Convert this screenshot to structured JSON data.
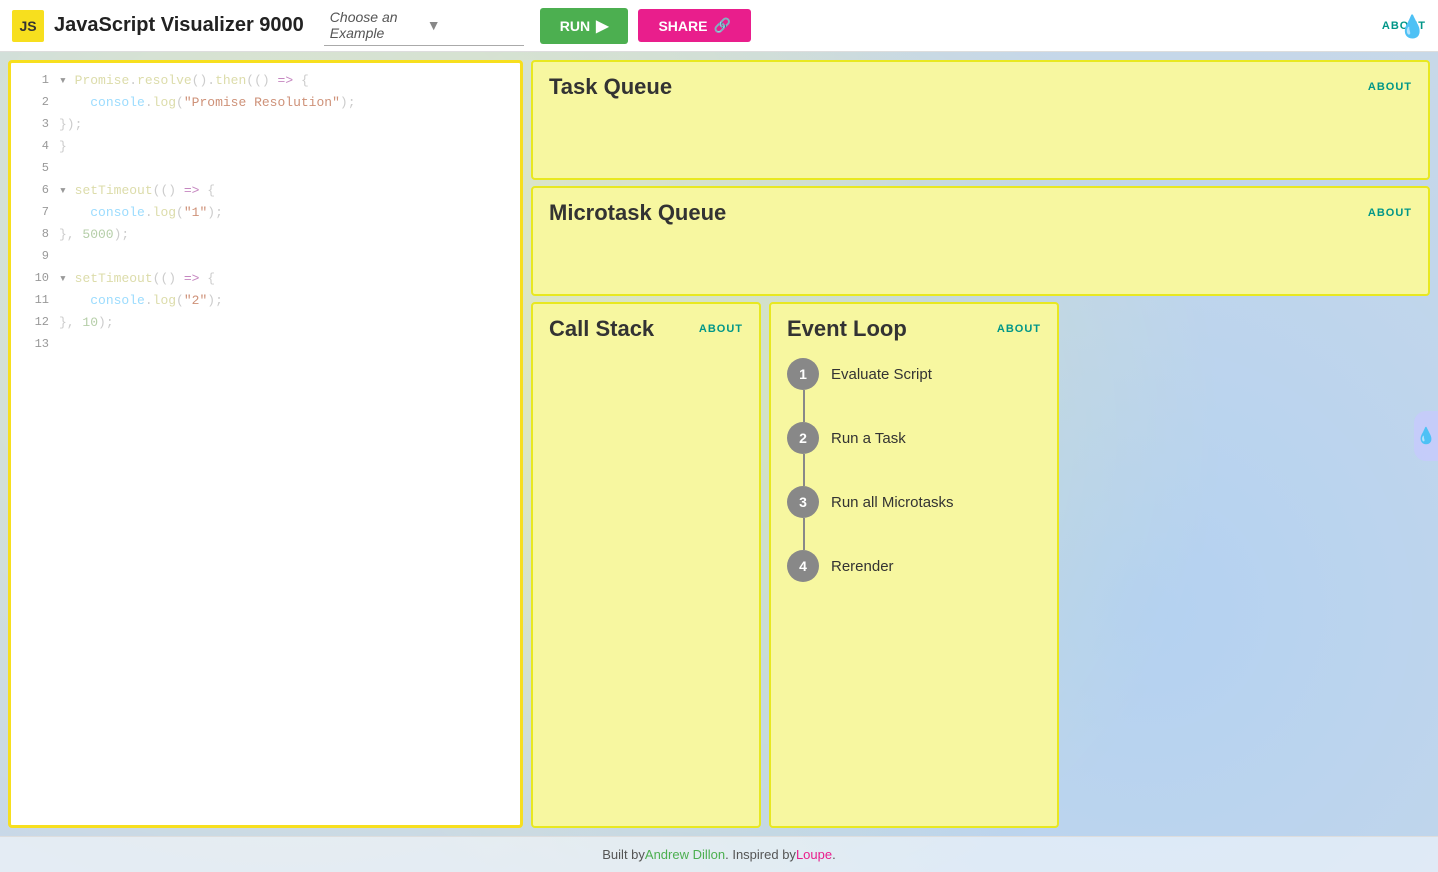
{
  "header": {
    "badge": "JS",
    "title": "JavaScript Visualizer 9000",
    "dropdown_placeholder": "Choose an Example",
    "run_label": "RUN",
    "share_label": "SHARE",
    "about_label": "ABOUT"
  },
  "code": {
    "lines": [
      {
        "num": "1",
        "tokens": [
          {
            "t": "collapse",
            "v": "▾ "
          },
          {
            "t": "fn",
            "v": "Promise"
          },
          {
            "t": "punc",
            "v": "."
          },
          {
            "t": "fn",
            "v": "resolve"
          },
          {
            "t": "punc",
            "v": "()."
          },
          {
            "t": "fn",
            "v": "then"
          },
          {
            "t": "punc",
            "v": "("
          },
          {
            "t": "punc",
            "v": "()"
          },
          {
            "t": "arrow",
            "v": " => "
          },
          {
            "t": "punc",
            "v": "{"
          }
        ]
      },
      {
        "num": "2",
        "tokens": [
          {
            "t": "spaces",
            "v": "    "
          },
          {
            "t": "dot",
            "v": "console"
          },
          {
            "t": "punc",
            "v": "."
          },
          {
            "t": "fn",
            "v": "log"
          },
          {
            "t": "punc",
            "v": "("
          },
          {
            "t": "str",
            "v": "\"Promise Resolution\""
          },
          {
            "t": "punc",
            "v": ")"
          },
          {
            "t": "punc",
            "v": ";"
          }
        ]
      },
      {
        "num": "3",
        "tokens": [
          {
            "t": "punc",
            "v": "});"
          }
        ]
      },
      {
        "num": "4",
        "tokens": [
          {
            "t": "punc",
            "v": "}"
          }
        ]
      },
      {
        "num": "5",
        "tokens": []
      },
      {
        "num": "6",
        "tokens": [
          {
            "t": "collapse",
            "v": "▾ "
          },
          {
            "t": "fn",
            "v": "setTimeout"
          },
          {
            "t": "punc",
            "v": "("
          },
          {
            "t": "punc",
            "v": "()"
          },
          {
            "t": "arrow",
            "v": " => "
          },
          {
            "t": "punc",
            "v": "{"
          }
        ]
      },
      {
        "num": "7",
        "tokens": [
          {
            "t": "spaces",
            "v": "    "
          },
          {
            "t": "dot",
            "v": "console"
          },
          {
            "t": "punc",
            "v": "."
          },
          {
            "t": "fn",
            "v": "log"
          },
          {
            "t": "punc",
            "v": "("
          },
          {
            "t": "str",
            "v": "\"1\""
          },
          {
            "t": "punc",
            "v": ")"
          },
          {
            "t": "punc",
            "v": ";"
          }
        ]
      },
      {
        "num": "8",
        "tokens": [
          {
            "t": "punc",
            "v": "}, "
          },
          {
            "t": "num",
            "v": "5000"
          },
          {
            "t": "punc",
            "v": ");"
          }
        ]
      },
      {
        "num": "9",
        "tokens": []
      },
      {
        "num": "10",
        "tokens": [
          {
            "t": "collapse",
            "v": "▾ "
          },
          {
            "t": "fn",
            "v": "setTimeout"
          },
          {
            "t": "punc",
            "v": "("
          },
          {
            "t": "punc",
            "v": "()"
          },
          {
            "t": "arrow",
            "v": " => "
          },
          {
            "t": "punc",
            "v": "{"
          }
        ]
      },
      {
        "num": "11",
        "tokens": [
          {
            "t": "spaces",
            "v": "    "
          },
          {
            "t": "dot",
            "v": "console"
          },
          {
            "t": "punc",
            "v": "."
          },
          {
            "t": "fn",
            "v": "log"
          },
          {
            "t": "punc",
            "v": "("
          },
          {
            "t": "str",
            "v": "\"2\""
          },
          {
            "t": "punc",
            "v": ")"
          },
          {
            "t": "punc",
            "v": ";"
          }
        ]
      },
      {
        "num": "12",
        "tokens": [
          {
            "t": "punc",
            "v": "}, "
          },
          {
            "t": "num",
            "v": "10"
          },
          {
            "t": "punc",
            "v": ");"
          }
        ]
      },
      {
        "num": "13",
        "tokens": []
      }
    ]
  },
  "task_queue": {
    "title": "Task Queue",
    "about_label": "ABOUT"
  },
  "microtask_queue": {
    "title": "Microtask Queue",
    "about_label": "ABOUT"
  },
  "call_stack": {
    "title": "Call Stack",
    "about_label": "ABOUT"
  },
  "event_loop": {
    "title": "Event Loop",
    "about_label": "ABOUT",
    "steps": [
      {
        "num": "1",
        "label": "Evaluate Script"
      },
      {
        "num": "2",
        "label": "Run a Task"
      },
      {
        "num": "3",
        "label": "Run all Microtasks"
      },
      {
        "num": "4",
        "label": "Rerender"
      }
    ]
  },
  "footer": {
    "prefix": "Built by ",
    "author": "Andrew Dillon",
    "middle": ". Inspired by ",
    "inspiration": "Loupe",
    "suffix": "."
  }
}
